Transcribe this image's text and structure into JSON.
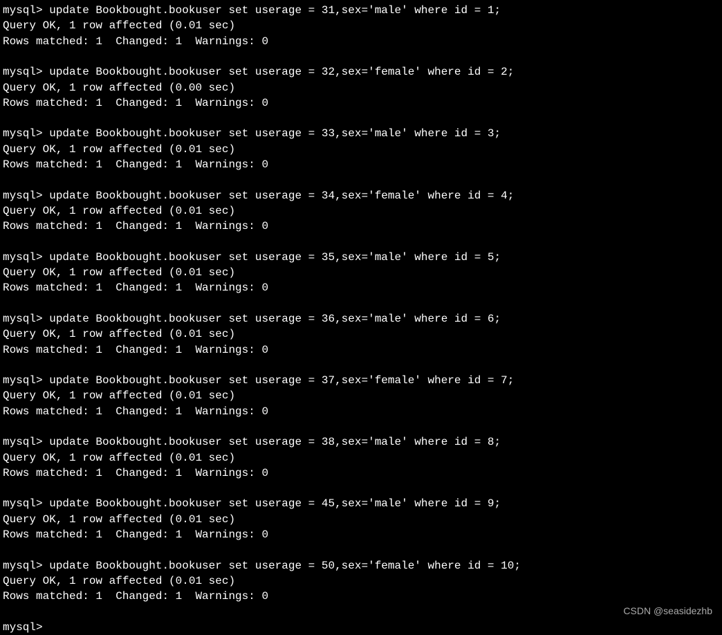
{
  "prompt": "mysql>",
  "queries": [
    {
      "command": "update Bookbought.bookuser set userage = 31,sex='male' where id = 1;",
      "result1": "Query OK, 1 row affected (0.01 sec)",
      "result2": "Rows matched: 1  Changed: 1  Warnings: 0"
    },
    {
      "command": "update Bookbought.bookuser set userage = 32,sex='female' where id = 2;",
      "result1": "Query OK, 1 row affected (0.00 sec)",
      "result2": "Rows matched: 1  Changed: 1  Warnings: 0"
    },
    {
      "command": "update Bookbought.bookuser set userage = 33,sex='male' where id = 3;",
      "result1": "Query OK, 1 row affected (0.01 sec)",
      "result2": "Rows matched: 1  Changed: 1  Warnings: 0"
    },
    {
      "command": "update Bookbought.bookuser set userage = 34,sex='female' where id = 4;",
      "result1": "Query OK, 1 row affected (0.01 sec)",
      "result2": "Rows matched: 1  Changed: 1  Warnings: 0"
    },
    {
      "command": "update Bookbought.bookuser set userage = 35,sex='male' where id = 5;",
      "result1": "Query OK, 1 row affected (0.01 sec)",
      "result2": "Rows matched: 1  Changed: 1  Warnings: 0"
    },
    {
      "command": "update Bookbought.bookuser set userage = 36,sex='male' where id = 6;",
      "result1": "Query OK, 1 row affected (0.01 sec)",
      "result2": "Rows matched: 1  Changed: 1  Warnings: 0"
    },
    {
      "command": "update Bookbought.bookuser set userage = 37,sex='female' where id = 7;",
      "result1": "Query OK, 1 row affected (0.01 sec)",
      "result2": "Rows matched: 1  Changed: 1  Warnings: 0"
    },
    {
      "command": "update Bookbought.bookuser set userage = 38,sex='male' where id = 8;",
      "result1": "Query OK, 1 row affected (0.01 sec)",
      "result2": "Rows matched: 1  Changed: 1  Warnings: 0"
    },
    {
      "command": "update Bookbought.bookuser set userage = 45,sex='male' where id = 9;",
      "result1": "Query OK, 1 row affected (0.01 sec)",
      "result2": "Rows matched: 1  Changed: 1  Warnings: 0"
    },
    {
      "command": "update Bookbought.bookuser set userage = 50,sex='female' where id = 10;",
      "result1": "Query OK, 1 row affected (0.01 sec)",
      "result2": "Rows matched: 1  Changed: 1  Warnings: 0"
    }
  ],
  "final_prompt": "mysql>",
  "watermark": "CSDN @seasidezhb"
}
